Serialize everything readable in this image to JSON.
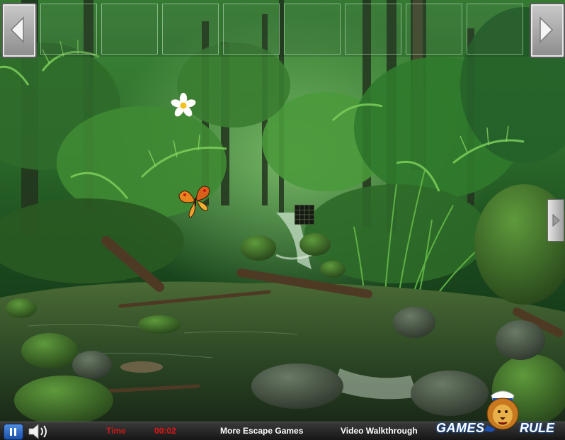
{
  "inventory": {
    "slot_count": 8,
    "left_arrow_icon": "chevron-left-icon",
    "right_arrow_icon": "chevron-right-icon"
  },
  "scene": {
    "nav_right_icon": "chevron-right-icon",
    "hotspots": [
      "flower",
      "butterfly",
      "number-grid"
    ]
  },
  "bottom_bar": {
    "pause_icon": "pause-icon",
    "sound_icon": "speaker-icon",
    "time_label": "Time",
    "time_value": "00:02",
    "more_games": "More Escape Games",
    "walkthrough": "Video Walkthrough"
  },
  "logo": {
    "left": "GAMES",
    "right": "RULE"
  },
  "colors": {
    "timer": "#e01414",
    "logo_glow": "#1d6de0",
    "bar": "#1e1e1e"
  }
}
